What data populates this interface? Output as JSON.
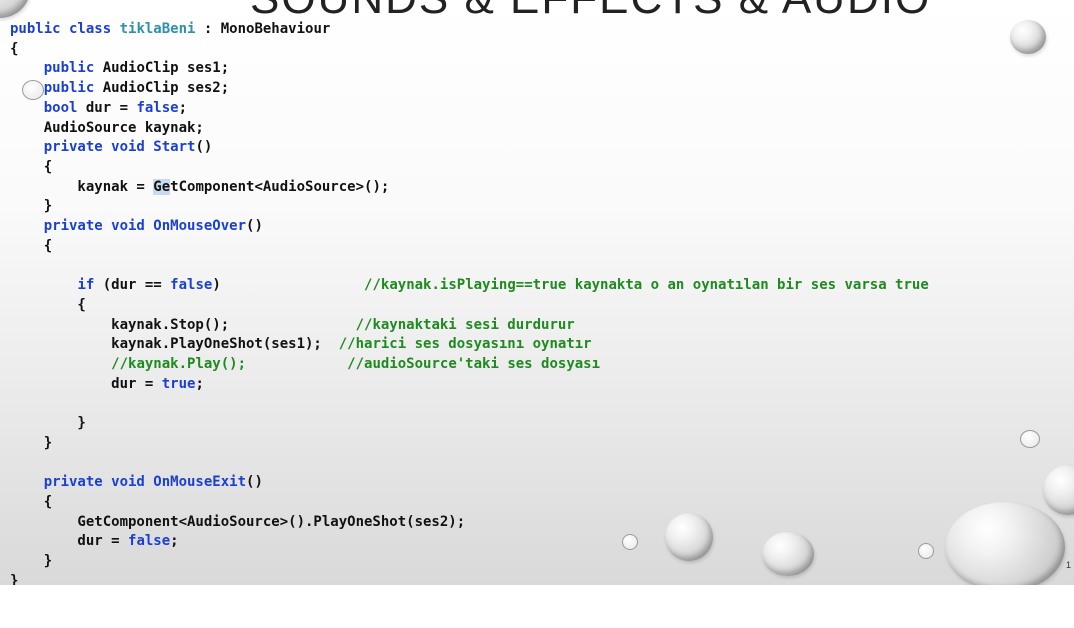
{
  "slide": {
    "title": "SOUNDS & EFFECTS & AUDIO",
    "page_number": "1"
  },
  "code_lines": [
    {
      "t": "tokens",
      "parts": [
        [
          "kw",
          "public"
        ],
        [
          "",
          ""
        ],
        [
          "kw",
          " class"
        ],
        [
          "ty",
          " tiklaBeni"
        ],
        [
          "",
          " : MonoBehaviour"
        ]
      ]
    },
    {
      "t": "plain",
      "text": "{"
    },
    {
      "t": "tokens",
      "parts": [
        [
          "",
          "    "
        ],
        [
          "kw",
          "public"
        ],
        [
          "",
          " AudioClip ses1;"
        ]
      ]
    },
    {
      "t": "tokens",
      "parts": [
        [
          "",
          "    "
        ],
        [
          "kw",
          "public"
        ],
        [
          "",
          " AudioClip ses2;"
        ]
      ]
    },
    {
      "t": "tokens",
      "parts": [
        [
          "",
          "    "
        ],
        [
          "kw",
          "bool"
        ],
        [
          "",
          " dur = "
        ],
        [
          "kw",
          "false"
        ],
        [
          "",
          ";"
        ]
      ]
    },
    {
      "t": "plain",
      "text": "    AudioSource kaynak;"
    },
    {
      "t": "tokens",
      "parts": [
        [
          "",
          "    "
        ],
        [
          "kw",
          "private void Start"
        ],
        [
          "",
          "()"
        ]
      ]
    },
    {
      "t": "plain",
      "text": "    {"
    },
    {
      "t": "tokens",
      "parts": [
        [
          "",
          "        kaynak = "
        ],
        [
          "hl",
          "Ge"
        ],
        [
          "",
          "tComponent<AudioSource>();"
        ]
      ]
    },
    {
      "t": "plain",
      "text": "    }"
    },
    {
      "t": "tokens",
      "parts": [
        [
          "",
          "    "
        ],
        [
          "kw",
          "private void OnMouseOver"
        ],
        [
          "",
          "()"
        ]
      ]
    },
    {
      "t": "plain",
      "text": "    {"
    },
    {
      "t": "plain",
      "text": ""
    },
    {
      "t": "tokens",
      "parts": [
        [
          "",
          "        "
        ],
        [
          "kw",
          "if"
        ],
        [
          "",
          " (dur == "
        ],
        [
          "kw",
          "false"
        ],
        [
          "",
          ")"
        ],
        [
          "",
          "                 "
        ],
        [
          "cm",
          "//kaynak.isPlaying==true kaynakta o an oynatılan bir ses varsa true"
        ]
      ]
    },
    {
      "t": "plain",
      "text": "        {"
    },
    {
      "t": "tokens",
      "parts": [
        [
          "",
          "            kaynak.Stop();"
        ],
        [
          "",
          "               "
        ],
        [
          "cm",
          "//kaynaktaki sesi durdurur"
        ]
      ]
    },
    {
      "t": "tokens",
      "parts": [
        [
          "",
          "            kaynak.PlayOneShot(ses1);"
        ],
        [
          "",
          "  "
        ],
        [
          "cm",
          "//harici ses dosyasını oynatır"
        ]
      ]
    },
    {
      "t": "tokens",
      "parts": [
        [
          "",
          "            "
        ],
        [
          "cm",
          "//kaynak.Play();"
        ],
        [
          "",
          "            "
        ],
        [
          "cm",
          "//audioSource'taki ses dosyası"
        ]
      ]
    },
    {
      "t": "tokens",
      "parts": [
        [
          "",
          "            dur = "
        ],
        [
          "kw",
          "true"
        ],
        [
          "",
          ";"
        ]
      ]
    },
    {
      "t": "plain",
      "text": ""
    },
    {
      "t": "plain",
      "text": "        }"
    },
    {
      "t": "plain",
      "text": "    }"
    },
    {
      "t": "plain",
      "text": ""
    },
    {
      "t": "tokens",
      "parts": [
        [
          "",
          "    "
        ],
        [
          "kw",
          "private void OnMouseExit"
        ],
        [
          "",
          "()"
        ]
      ]
    },
    {
      "t": "plain",
      "text": "    {"
    },
    {
      "t": "plain",
      "text": "        GetComponent<AudioSource>().PlayOneShot(ses2);"
    },
    {
      "t": "tokens",
      "parts": [
        [
          "",
          "        dur = "
        ],
        [
          "kw",
          "false"
        ],
        [
          "",
          ";"
        ]
      ]
    },
    {
      "t": "plain",
      "text": "    }"
    },
    {
      "t": "plain",
      "text": "}"
    }
  ]
}
